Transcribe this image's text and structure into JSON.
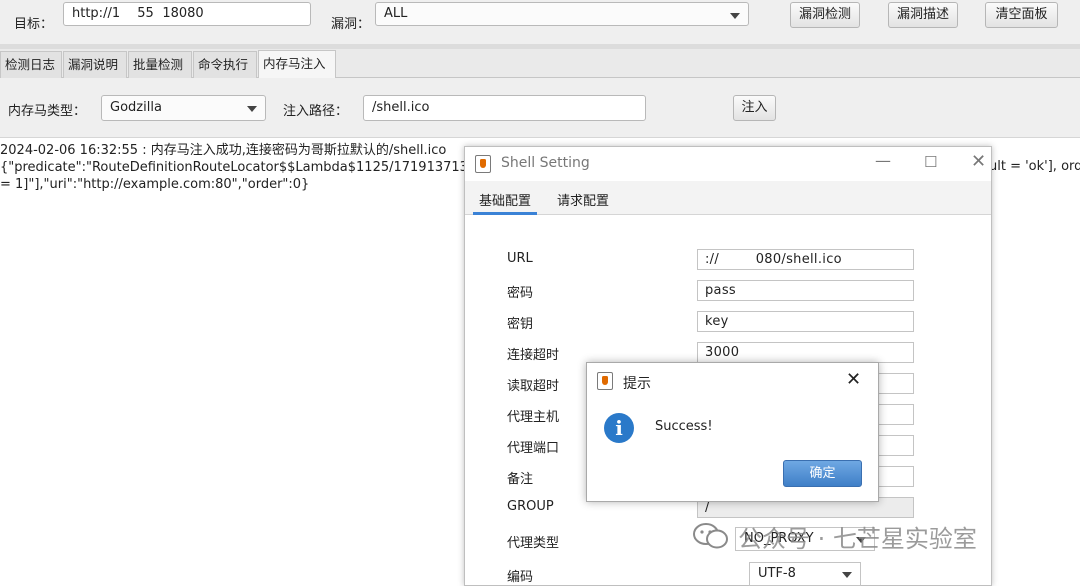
{
  "toolbar": {
    "target_label": "目标：",
    "target_value": "http://1    55  18080",
    "vuln_label": "漏洞：",
    "vuln_value": "ALL",
    "detect_button": "漏洞检测",
    "describe_button": "漏洞描述",
    "clear_button": "清空面板"
  },
  "tabs": [
    "检测日志",
    "漏洞说明",
    "批量检测",
    "命令执行",
    "内存马注入"
  ],
  "inject": {
    "type_label": "内存马类型：",
    "type_value": "Godzilla",
    "path_label": "注入路径：",
    "path_value": "/shell.ico",
    "inject_button": "注入"
  },
  "log": {
    "line1": "2024-02-06 16:32:55 : 内存马注入成功,连接密码为哥斯拉默认的/shell.ico",
    "line2a": "{\"predicate\":\"RouteDefinitionRouteLocator$$Lambda$1125/1719137132\",\"",
    "line2b": "ult = 'ok'], orde",
    "line3": "= 1]\"],\"uri\":\"http://example.com:80\",\"order\":0}"
  },
  "shell_setting": {
    "title": "Shell Setting",
    "tabs": [
      "基础配置",
      "请求配置"
    ],
    "fields": [
      {
        "label": "URL",
        "value": "://        080/shell.ico"
      },
      {
        "label": "密码",
        "value": "pass"
      },
      {
        "label": "密钥",
        "value": "key"
      },
      {
        "label": "连接超时",
        "value": "3000"
      },
      {
        "label": "读取超时",
        "value": ""
      },
      {
        "label": "代理主机",
        "value": ""
      },
      {
        "label": "代理端口",
        "value": ""
      },
      {
        "label": "备注",
        "value": ""
      },
      {
        "label": "GROUP",
        "value": "/"
      }
    ],
    "proxy_type_label": "代理类型",
    "proxy_type_value": "NO_PROXY",
    "encoding_label": "编码",
    "encoding_value": "UTF-8"
  },
  "dialog": {
    "title": "提示",
    "message": "Success!",
    "ok_button": "确定"
  },
  "watermark": "公众号 · 七芒星实验室",
  "colors": {
    "accent": "#3a82d6",
    "info_icon": "#2a79c9",
    "ok_button": "#4a88cf"
  }
}
